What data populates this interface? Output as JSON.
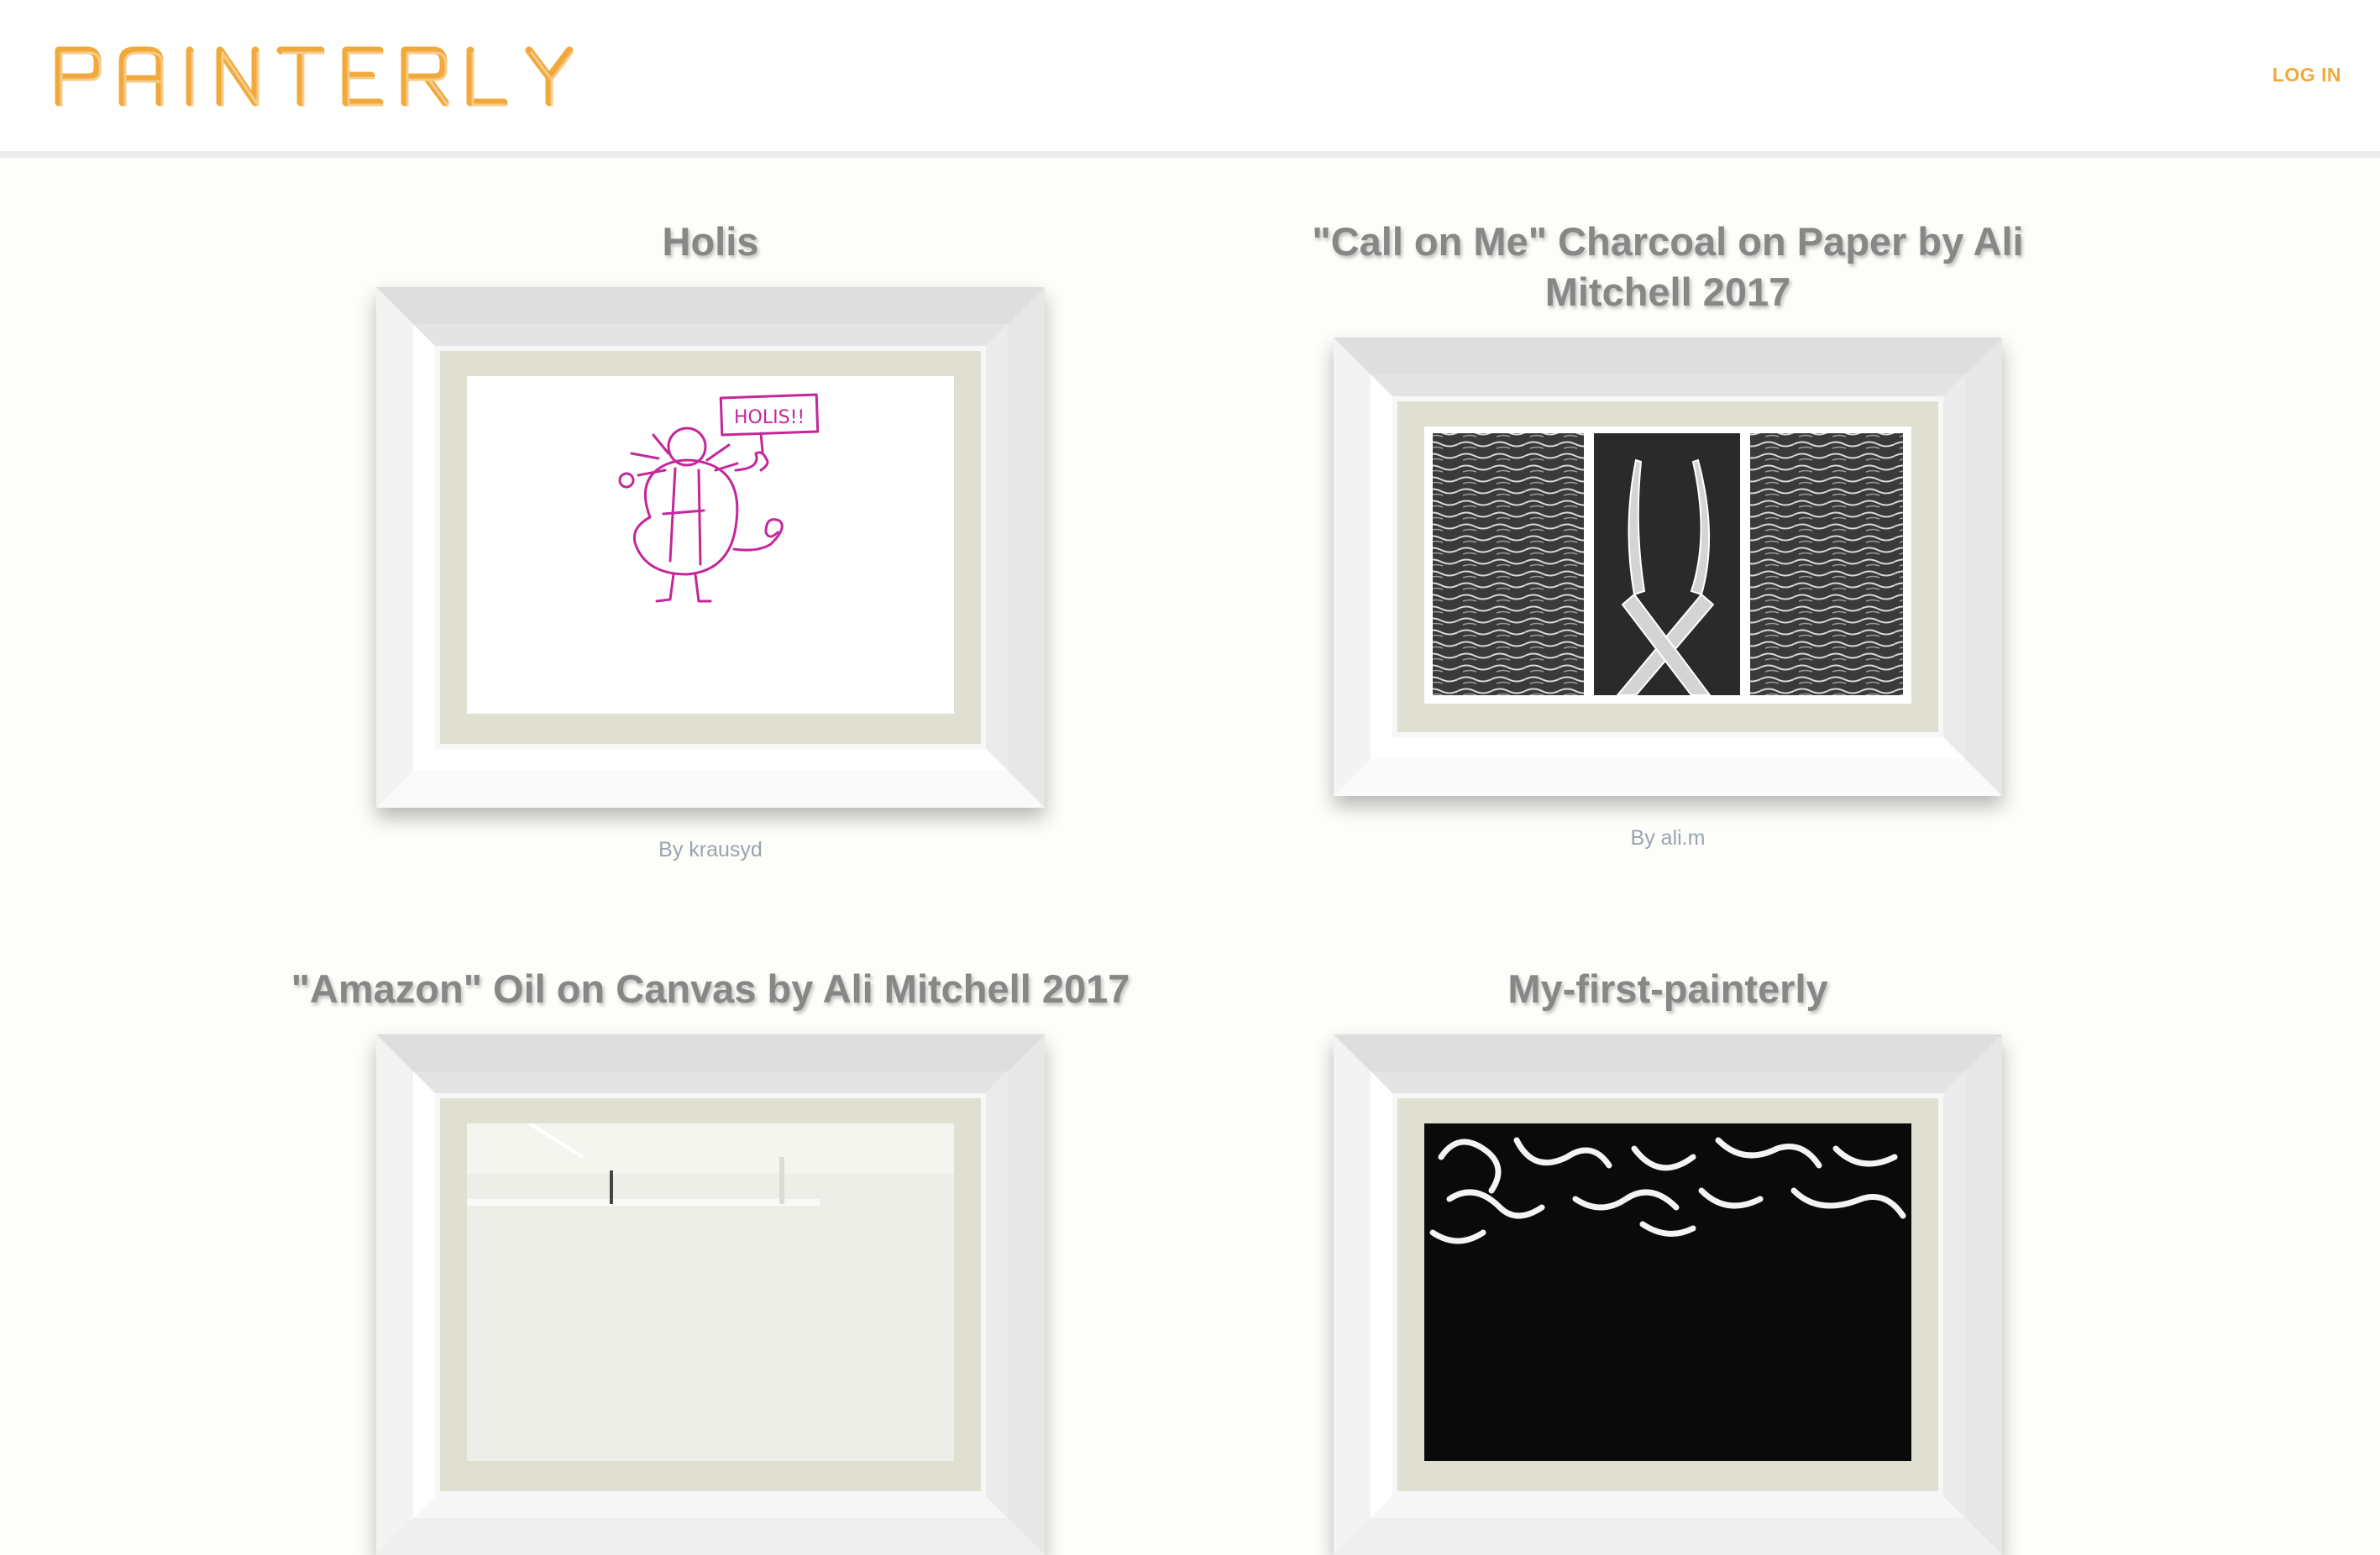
{
  "header": {
    "logo_text": "PAINTERLY",
    "login_label": "LOG IN"
  },
  "paintings": [
    {
      "title": "Holis",
      "byline": "By krausyd",
      "drawing_text": "HOLIS!!"
    },
    {
      "title": "\"Call on Me\" Charcoal on Paper by Ali Mitchell 2017",
      "byline": "By ali.m"
    },
    {
      "title": "\"Amazon\" Oil on Canvas by Ali Mitchell 2017",
      "byline": ""
    },
    {
      "title": "My-first-painterly",
      "byline": ""
    }
  ],
  "colors": {
    "accent": "#f2a93b",
    "title_gray": "#878787",
    "byline_gray": "#9aa4b0",
    "mat": "#dfe0d2",
    "page_bg": "#fdfdf9"
  }
}
